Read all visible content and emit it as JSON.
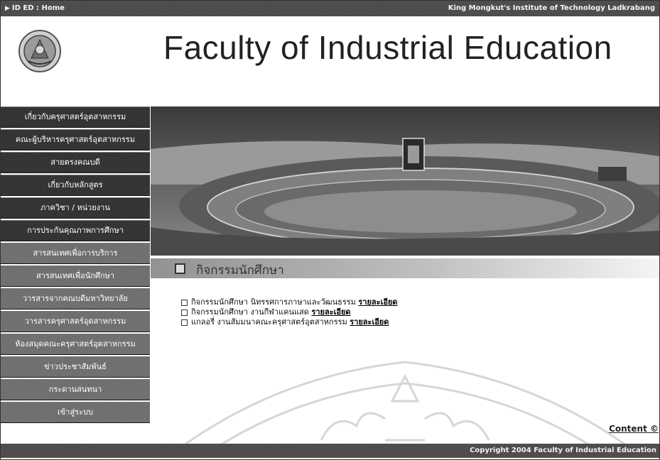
{
  "topbar": {
    "home_label": "ID ED : Home",
    "institute": "King Mongkut's Institute of Technology Ladkrabang"
  },
  "header": {
    "title": "Faculty of Industrial Education"
  },
  "sidebar": {
    "items": [
      {
        "label": "เกี่ยวกับครุศาสตร์อุตสาหกรรม",
        "tone": "dark"
      },
      {
        "label": "คณะผู้บริหารครุศาสตร์อุตสาหกรรม",
        "tone": "dark"
      },
      {
        "label": "สายตรงคณบดี",
        "tone": "dark"
      },
      {
        "label": "เกี่ยวกับหลักสูตร",
        "tone": "dark"
      },
      {
        "label": "ภาควิชา / หน่วยงาน",
        "tone": "dark"
      },
      {
        "label": "การประกันคุณภาพการศึกษา",
        "tone": "dark"
      },
      {
        "label": "สารสนเทศเพื่อการบริการ",
        "tone": "light"
      },
      {
        "label": "สารสนเทศเพื่อนักศึกษา",
        "tone": "light"
      },
      {
        "label": "วารสารจากคณบดีมหาวิทยาลัย",
        "tone": "light"
      },
      {
        "label": "วารสารครุศาสตร์อุตสาหกรรม",
        "tone": "light"
      },
      {
        "label": "ห้องสมุดคณะครุศาสตร์อุตสาหกรรม",
        "tone": "light"
      },
      {
        "label": "ข่าวประชาสัมพันธ์",
        "tone": "light"
      },
      {
        "label": "กระดานสนทนา",
        "tone": "light"
      },
      {
        "label": "เข้าสู่ระบบ",
        "tone": "light"
      }
    ]
  },
  "section": {
    "title": "กิจกรรมนักศึกษา"
  },
  "activities": [
    {
      "text": "กิจกรรมนักศึกษา นิทรรศการภาษาและวัฒนธรรม",
      "link": "รายละเอียด"
    },
    {
      "text": "กิจกรรมนักศึกษา งานกีฬาแคนแสด",
      "link": "รายละเอียด"
    },
    {
      "text": "แกลอรี่ งานสัมมนาคณะครุศาสตร์อุตสาหกรรม",
      "link": "รายละเอียด"
    }
  ],
  "content_link": "Content ©",
  "footer": {
    "copyright": "Copyright   2004 Faculty of Industrial Education"
  },
  "colors": {
    "bar": "#4a4a4a",
    "nav_dark": "#2f2f2f",
    "nav_light": "#6a6a6a"
  }
}
